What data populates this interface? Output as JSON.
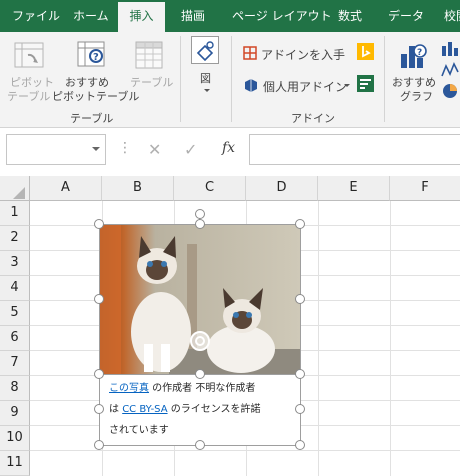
{
  "ribbon": {
    "tabs": [
      {
        "label": "ファイル",
        "active": false
      },
      {
        "label": "ホーム",
        "active": false
      },
      {
        "label": "挿入",
        "active": true
      },
      {
        "label": "描画",
        "active": false
      },
      {
        "label": "ページ レイアウト",
        "active": false
      },
      {
        "label": "数式",
        "active": false
      },
      {
        "label": "データ",
        "active": false
      },
      {
        "label": "校閲",
        "active": false
      }
    ],
    "groups": {
      "table": {
        "label": "テーブル",
        "pivot_line1": "ピボット",
        "pivot_line2": "テーブル",
        "rec_pivot_line1": "おすすめ",
        "rec_pivot_line2": "ピボットテーブル",
        "table_button": "テーブル"
      },
      "illustrations": {
        "label": "図"
      },
      "addins": {
        "label": "アドイン",
        "get_addins": "アドインを入手",
        "my_addins": "個人用アドイン"
      },
      "charts": {
        "rec_chart_line1": "おすすめ",
        "rec_chart_line2": "グラフ"
      }
    }
  },
  "formula_bar": {
    "name_box_value": "",
    "formula_value": "",
    "fx_label": "fx",
    "cancel_glyph": "✕",
    "enter_glyph": "✓",
    "more_glyph": "⋮"
  },
  "sheet": {
    "columns": [
      "A",
      "B",
      "C",
      "D",
      "E",
      "F"
    ],
    "rows": [
      "1",
      "2",
      "3",
      "4",
      "5",
      "6",
      "7",
      "8",
      "9",
      "10",
      "11"
    ]
  },
  "picture_caption": {
    "link1": "この写真",
    "text1": " の作成者 不明な作成者",
    "text2a": "は ",
    "link2": "CC BY-SA",
    "text2b": " のライセンスを許諾",
    "text3": "されています"
  },
  "colors": {
    "accent_green": "#217346",
    "link_blue": "#0563c1",
    "bing_yellow": "#ffb900",
    "store_green": "#217346"
  }
}
